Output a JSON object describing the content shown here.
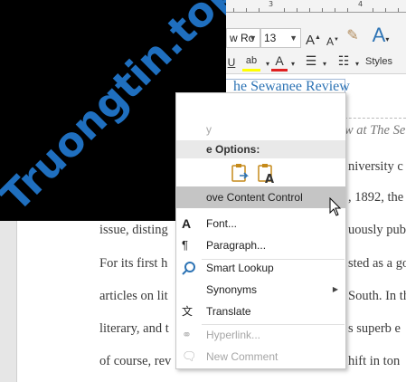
{
  "ribbon": {
    "ruler_numbers": [
      "3",
      "4"
    ],
    "font_name": "w Ro",
    "font_size": "13",
    "styles_label": "Styles"
  },
  "document": {
    "title": "he Sewanee Review",
    "italic_line": "w at The Se",
    "lines": [
      "niversity c",
      ", 1892, the",
      "issue, disting",
      "uously pub",
      "For its first h",
      "sted as a go",
      "articles on lit",
      "South. In th",
      "literary, and t",
      "s superb e",
      "of course, rev",
      "hift in ton"
    ]
  },
  "watermark": {
    "text": "Truongtin.top"
  },
  "menu": {
    "faded_item": "y",
    "paste_options_label": "e Options:",
    "remove_cc": "ove Content Control",
    "font": "Font...",
    "paragraph": "Paragraph...",
    "smart_lookup": "Smart Lookup",
    "synonyms": "Synonyms",
    "translate": "Translate",
    "hyperlink": "Hyperlink...",
    "new_comment": "New Comment"
  },
  "colors": {
    "title_blue": "#2e74b5",
    "watermark_blue": "#1f6fbf",
    "highlight_yellow": "#ffff00",
    "font_red": "#e02020"
  }
}
